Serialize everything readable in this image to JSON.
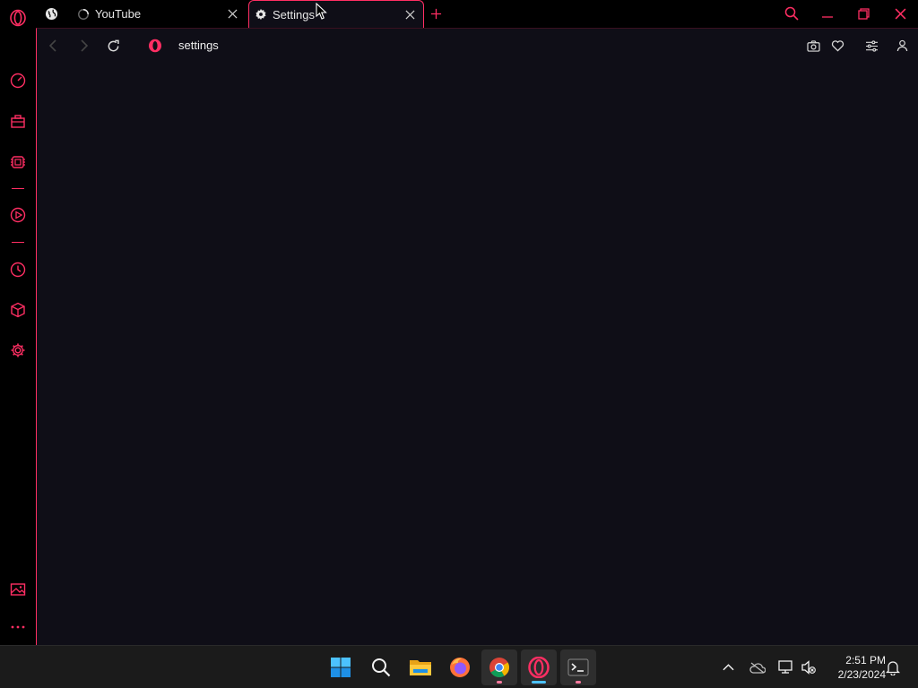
{
  "colors": {
    "accent": "#ff2e63",
    "background": "#000000",
    "content_bg": "#0f0e17",
    "taskbar_bg": "#1b1b1b"
  },
  "sidebar": {
    "items": [
      {
        "name": "opera-logo",
        "icon": "opera-o-icon"
      },
      {
        "name": "speed-dial",
        "icon": "speedometer-icon"
      },
      {
        "name": "workspaces",
        "icon": "briefcase-icon"
      },
      {
        "name": "extensions",
        "icon": "chip-icon"
      },
      {
        "name": "player",
        "icon": "play-circle-icon"
      },
      {
        "name": "history",
        "icon": "clock-icon"
      },
      {
        "name": "extension-cube",
        "icon": "cube-icon"
      },
      {
        "name": "settings",
        "icon": "gear-icon"
      },
      {
        "name": "wallpaper",
        "icon": "image-icon"
      },
      {
        "name": "more",
        "icon": "more-icon"
      }
    ]
  },
  "tabs": [
    {
      "title": "YouTube",
      "icon": "loading-spinner-icon",
      "active": false
    },
    {
      "title": "Settings",
      "icon": "gear-icon",
      "active": true
    }
  ],
  "window_controls": [
    "search-icon",
    "minimize-icon",
    "restore-icon",
    "close-icon"
  ],
  "toolbar": {
    "address": "settings",
    "buttons": [
      "back-icon",
      "forward-icon",
      "reload-icon",
      "camera-icon",
      "heart-icon",
      "easy-setup-icon",
      "profile-icon"
    ]
  },
  "taskbar": {
    "apps": [
      {
        "name": "start",
        "icon": "windows-icon"
      },
      {
        "name": "search",
        "icon": "search-icon"
      },
      {
        "name": "file-explorer",
        "icon": "folder-icon"
      },
      {
        "name": "firefox",
        "icon": "firefox-icon"
      },
      {
        "name": "chrome",
        "icon": "chrome-icon"
      },
      {
        "name": "opera",
        "icon": "opera-icon"
      },
      {
        "name": "terminal",
        "icon": "terminal-icon"
      }
    ],
    "tray": [
      "chevron-up-icon",
      "onedrive-icon",
      "network-icon",
      "volume-muted-icon",
      "notification-bell-icon"
    ],
    "time": "2:51 PM",
    "date": "2/23/2024"
  }
}
